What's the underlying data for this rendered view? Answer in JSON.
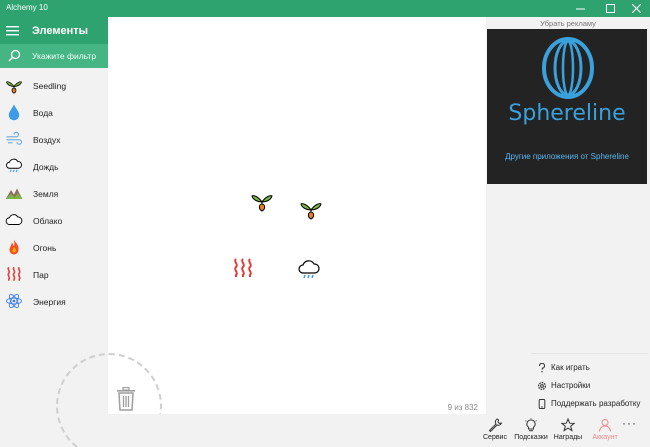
{
  "window": {
    "title": "Alchemy 10"
  },
  "sidebar": {
    "heading": "Элементы",
    "filter_placeholder": "Укажите фильтр",
    "items": [
      {
        "label": "Seedling",
        "icon": "seedling-icon"
      },
      {
        "label": "Вода",
        "icon": "water-drop-icon"
      },
      {
        "label": "Воздух",
        "icon": "air-wind-icon"
      },
      {
        "label": "Дождь",
        "icon": "rain-cloud-icon"
      },
      {
        "label": "Земля",
        "icon": "earth-mountains-icon"
      },
      {
        "label": "Облако",
        "icon": "cloud-icon"
      },
      {
        "label": "Огонь",
        "icon": "fire-icon"
      },
      {
        "label": "Пар",
        "icon": "steam-icon"
      },
      {
        "label": "Энергия",
        "icon": "energy-atom-icon"
      }
    ]
  },
  "canvas": {
    "counter": "9 из 832",
    "items": [
      {
        "icon": "seedling-icon"
      },
      {
        "icon": "seedling-icon"
      },
      {
        "icon": "steam-icon"
      },
      {
        "icon": "rain-cloud-icon"
      }
    ]
  },
  "ad": {
    "remove_ads": "Убрать рекламу",
    "brand": "Sphereline",
    "more_apps": "Другие приложения от Sphereline",
    "brand_color": "#3aa1dd"
  },
  "menu": {
    "items": [
      {
        "label": "Как играть",
        "icon": "question-icon"
      },
      {
        "label": "Настройки",
        "icon": "gear-icon"
      },
      {
        "label": "Поддержать разработку",
        "icon": "phone-icon"
      }
    ]
  },
  "bottom_bar": {
    "service": "Сервис",
    "hints": "Подсказки",
    "awards": "Награды",
    "account": "Аккаунт",
    "more": "···"
  },
  "colors": {
    "accent": "#2fa36f",
    "filter_bg": "#45b584",
    "account": "#f08a8a"
  }
}
